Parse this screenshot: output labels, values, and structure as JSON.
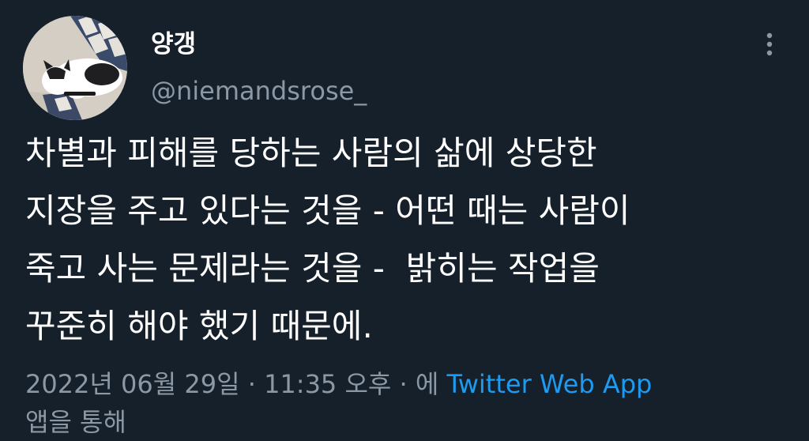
{
  "author": {
    "display_name": "양갱",
    "handle": "@niemandsrose_"
  },
  "tweet": {
    "lines": [
      "차별과 피해를 당하는 사람의 삶에 상당한",
      "지장을 주고 있다는 것을 - 어떤 때는 사람이",
      "죽고 사는 문제라는 것을 -  밝히는 작업을",
      "꾸준히 해야 했기 때문에."
    ]
  },
  "meta": {
    "date": "2022년 06월 29일",
    "separator1": " · ",
    "time": "11:35 오후",
    "separator2": " · ",
    "via_prefix": "에 ",
    "source": "Twitter Web App",
    "via_suffix": "앱을 통해"
  },
  "colors": {
    "background": "#15202b",
    "primary_text": "#ffffff",
    "secondary_text": "#8b98a5",
    "link": "#1d9bf0"
  },
  "icons": {
    "more": "more-vertical-icon",
    "avatar": "cat-avatar-photo"
  }
}
